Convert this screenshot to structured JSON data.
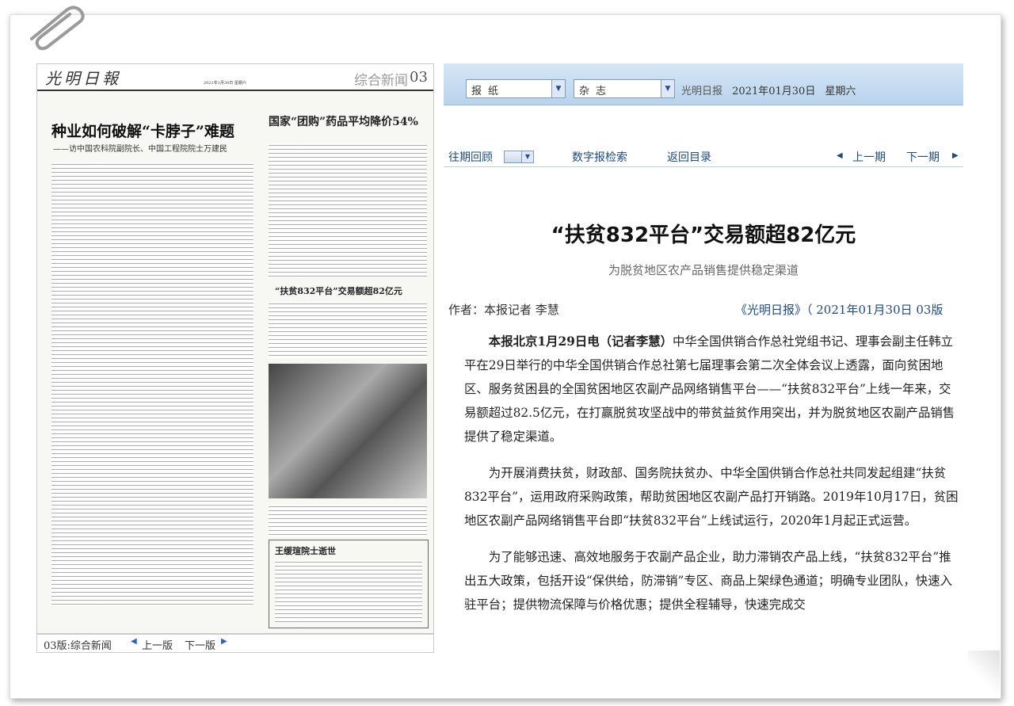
{
  "paper_page": {
    "logo": "光明日報",
    "date_line": "2021年1月30日 星期六",
    "section": "综合新闻",
    "number": "03",
    "headline": "种业如何破解“卡脖子”难题",
    "subline": "——访中国农科院副院长、中国工程院院士万建民",
    "headline2": "国家“团购”药品平均降价54%",
    "headline3": "“扶贫832平台”交易额超82亿元",
    "headline4": "王缓瑄院士逝世"
  },
  "bottom_nav": {
    "section": "03版:综合新闻",
    "prev": "上一版",
    "next": "下一版"
  },
  "topbar": {
    "select1": "报纸",
    "select2": "杂志",
    "paper_name": "光明日报",
    "date": "2021年01月30日",
    "weekday": "星期六"
  },
  "navbar": {
    "archive": "往期回顾",
    "digital": "数字报检索",
    "back": "返回目录",
    "prev": "上一期",
    "next": "下一期"
  },
  "article": {
    "title": "“扶贫832平台”交易额超82亿元",
    "subtitle": "为脱贫地区农产品销售提供稳定渠道",
    "author": "作者：本报记者  李慧",
    "source": "《光明日报》（ 2021年01月30日   03版",
    "lead_bold": "本报北京1月29日电（记者李慧）",
    "p1": "中华全国供销合作总社党组书记、理事会副主任韩立平在29日举行的中华全国供销合作总社第七届理事会第二次全体会议上透露，面向贫困地区、服务贫困县的全国贫困地区农副产品网络销售平台——“扶贫832平台”上线一年来，交易额超过82.5亿元，在打赢脱贫攻坚战中的带贫益贫作用突出，并为脱贫地区农副产品销售提供了稳定渠道。",
    "p2": "为开展消费扶贫，财政部、国务院扶贫办、中华全国供销合作总社共同发起组建“扶贫832平台”，运用政府采购政策，帮助贫困地区农副产品打开销路。2019年10月17日，贫困地区农副产品网络销售平台即“扶贫832平台”上线试运行，2020年1月起正式运营。",
    "p3": "为了能够迅速、高效地服务于农副产品企业，助力滞销农产品上线，“扶贫832平台”推出五大政策，包括开设“保供给，防滞销”专区、商品上架绿色通道；明确专业团队，快速入驻平台；提供物流保障与价格优惠；提供全程辅导，快速完成交"
  }
}
